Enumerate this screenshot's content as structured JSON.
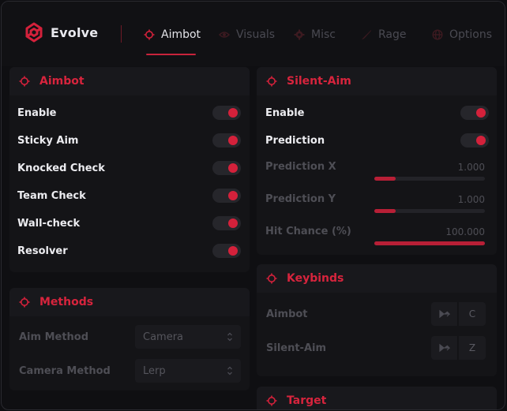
{
  "brand": {
    "name": "Evolve",
    "accent": "#d4213b"
  },
  "tabs": [
    {
      "label": "Aimbot",
      "icon": "crosshair-icon",
      "active": true
    },
    {
      "label": "Visuals",
      "icon": "eye-icon",
      "active": false
    },
    {
      "label": "Misc",
      "icon": "gear-icon",
      "active": false
    },
    {
      "label": "Rage",
      "icon": "knife-icon",
      "active": false
    },
    {
      "label": "Options",
      "icon": "globe-icon",
      "active": false
    }
  ],
  "aimbot_panel": {
    "title": "Aimbot",
    "items": [
      {
        "label": "Enable",
        "on": true
      },
      {
        "label": "Sticky Aim",
        "on": true
      },
      {
        "label": "Knocked Check",
        "on": true
      },
      {
        "label": "Team Check",
        "on": true
      },
      {
        "label": "Wall-check",
        "on": true
      },
      {
        "label": "Resolver",
        "on": true
      }
    ]
  },
  "methods_panel": {
    "title": "Methods",
    "fields": [
      {
        "label": "Aim Method",
        "value": "Camera"
      },
      {
        "label": "Camera Method",
        "value": "Lerp"
      }
    ]
  },
  "silent_panel": {
    "title": "Silent-Aim",
    "toggles": [
      {
        "label": "Enable",
        "on": true
      },
      {
        "label": "Prediction",
        "on": true
      }
    ],
    "sliders": [
      {
        "label": "Prediction X",
        "value": "1.000",
        "fill": 0.19
      },
      {
        "label": "Prediction Y",
        "value": "1.000",
        "fill": 0.19
      },
      {
        "label": "Hit Chance (%)",
        "value": "100.000",
        "fill": 1.0
      }
    ]
  },
  "keybinds_panel": {
    "title": "Keybinds",
    "binds": [
      {
        "label": "Aimbot",
        "icon": "cursor-icon",
        "key": "C"
      },
      {
        "label": "Silent-Aim",
        "icon": "cursor-icon",
        "key": "Z"
      }
    ]
  },
  "target_panel": {
    "title": "Target"
  }
}
